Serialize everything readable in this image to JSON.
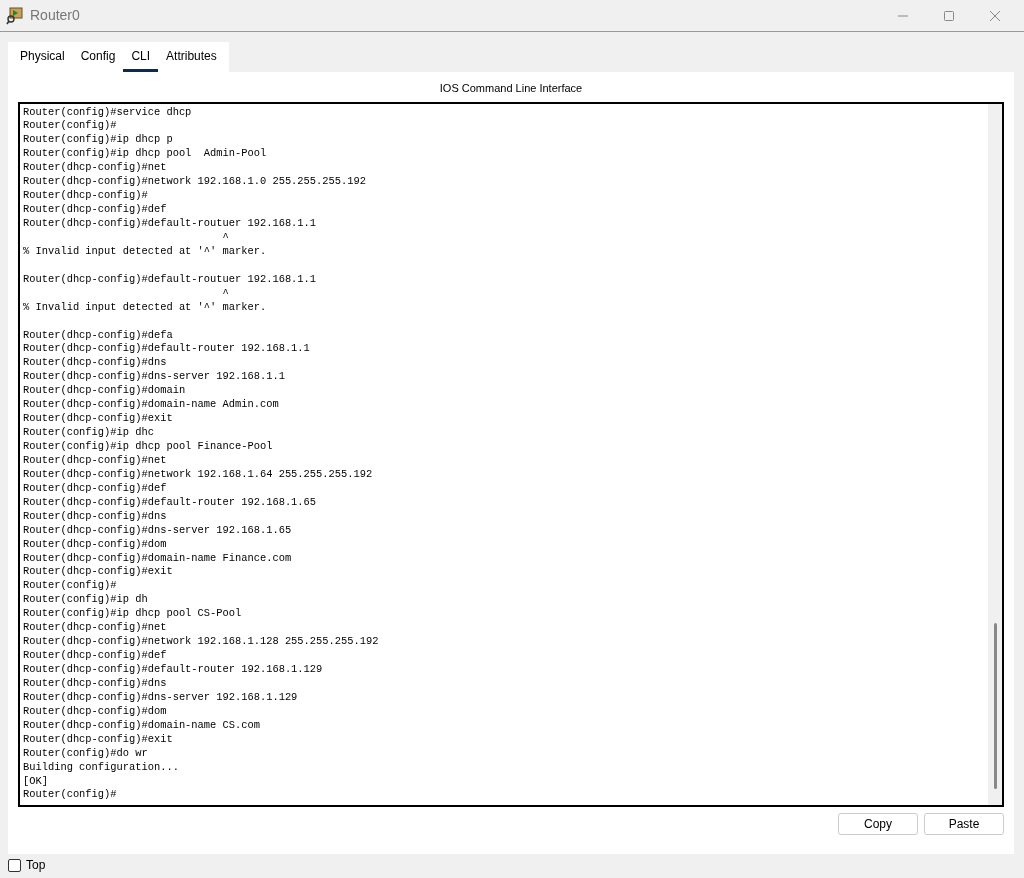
{
  "window": {
    "title": "Router0"
  },
  "tabs": [
    {
      "label": "Physical",
      "selected": false
    },
    {
      "label": "Config",
      "selected": false
    },
    {
      "label": "CLI",
      "selected": true
    },
    {
      "label": "Attributes",
      "selected": false
    }
  ],
  "cli": {
    "heading": "IOS Command Line Interface",
    "lines": [
      {
        "text": "Router(config)#service dhcp"
      },
      {
        "text": "Router(config)#"
      },
      {
        "text": "Router(config)#ip dhcp p"
      },
      {
        "text": "Router(config)#ip dhcp pool  Admin-Pool"
      },
      {
        "text": "Router(dhcp-config)#net"
      },
      {
        "text": "Router(dhcp-config)#network 192.168.1.0 255.255.255.192"
      },
      {
        "text": "Router(dhcp-config)#"
      },
      {
        "text": "Router(dhcp-config)#def"
      },
      {
        "text": "Router(dhcp-config)#default-routuer 192.168.1.1"
      },
      {
        "text": "                                ^"
      },
      {
        "text": "% Invalid input detected at '^' marker."
      },
      {
        "text": "Router(dhcp-config)#default-routuer 192.168.1.1",
        "blank_line_before": true
      },
      {
        "text": "                                ^"
      },
      {
        "text": "% Invalid input detected at '^' marker."
      },
      {
        "text": "Router(dhcp-config)#defa",
        "blank_line_before": true
      },
      {
        "text": "Router(dhcp-config)#default-router 192.168.1.1"
      },
      {
        "text": "Router(dhcp-config)#dns"
      },
      {
        "text": "Router(dhcp-config)#dns-server 192.168.1.1"
      },
      {
        "text": "Router(dhcp-config)#domain"
      },
      {
        "text": "Router(dhcp-config)#domain-name Admin.com"
      },
      {
        "text": "Router(dhcp-config)#exit"
      },
      {
        "text": "Router(config)#ip dhc"
      },
      {
        "text": "Router(config)#ip dhcp pool Finance-Pool"
      },
      {
        "text": "Router(dhcp-config)#net"
      },
      {
        "text": "Router(dhcp-config)#network 192.168.1.64 255.255.255.192"
      },
      {
        "text": "Router(dhcp-config)#def"
      },
      {
        "text": "Router(dhcp-config)#default-router 192.168.1.65"
      },
      {
        "text": "Router(dhcp-config)#dns"
      },
      {
        "text": "Router(dhcp-config)#dns-server 192.168.1.65"
      },
      {
        "text": "Router(dhcp-config)#dom"
      },
      {
        "text": "Router(dhcp-config)#domain-name Finance.com"
      },
      {
        "text": "Router(dhcp-config)#exit"
      },
      {
        "text": "Router(config)#"
      },
      {
        "text": "Router(config)#ip dh"
      },
      {
        "text": "Router(config)#ip dhcp pool CS-Pool"
      },
      {
        "text": "Router(dhcp-config)#net"
      },
      {
        "text": "Router(dhcp-config)#network 192.168.1.128 255.255.255.192"
      },
      {
        "text": "Router(dhcp-config)#def"
      },
      {
        "text": "Router(dhcp-config)#default-router 192.168.1.129"
      },
      {
        "text": "Router(dhcp-config)#dns"
      },
      {
        "text": "Router(dhcp-config)#dns-server 192.168.1.129"
      },
      {
        "text": "Router(dhcp-config)#dom"
      },
      {
        "text": "Router(dhcp-config)#domain-name CS.com"
      },
      {
        "text": "Router(dhcp-config)#exit"
      },
      {
        "text": "Router(config)#do wr"
      },
      {
        "text": "Building configuration..."
      },
      {
        "text": "[OK]"
      },
      {
        "text": "Router(config)#"
      }
    ],
    "buttons": [
      "Copy",
      "Paste"
    ]
  },
  "top_checkbox": {
    "label": "Top",
    "checked": false
  }
}
